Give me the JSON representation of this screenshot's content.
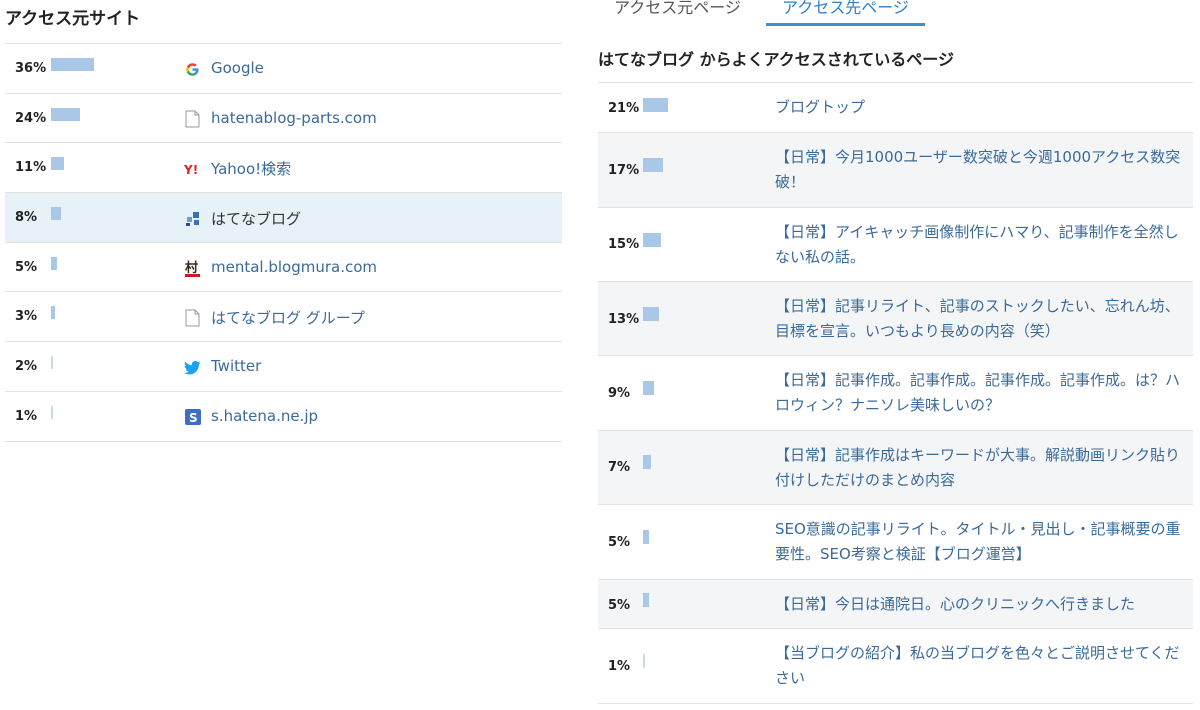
{
  "left": {
    "title": "アクセス元サイト",
    "rows": [
      {
        "pct": "36%",
        "fraction": 0.36,
        "icon": "google-icon",
        "name": "Google"
      },
      {
        "pct": "24%",
        "fraction": 0.24,
        "icon": "page-icon",
        "name": "hatenablog-parts.com"
      },
      {
        "pct": "11%",
        "fraction": 0.11,
        "icon": "yahoo-icon",
        "name": "Yahoo!検索"
      },
      {
        "pct": "8%",
        "fraction": 0.08,
        "icon": "hatenablog-icon",
        "name": "はてなブログ",
        "highlight": true
      },
      {
        "pct": "5%",
        "fraction": 0.05,
        "icon": "blogmura-icon",
        "name": "mental.blogmura.com"
      },
      {
        "pct": "3%",
        "fraction": 0.03,
        "icon": "page-icon",
        "name": "はてなブログ グループ"
      },
      {
        "pct": "2%",
        "fraction": 0.02,
        "icon": "twitter-icon",
        "name": "Twitter"
      },
      {
        "pct": "1%",
        "fraction": 0.01,
        "icon": "hatena-s-icon",
        "name": "s.hatena.ne.jp"
      }
    ]
  },
  "right": {
    "tabs": [
      {
        "label": "アクセス元ページ",
        "active": false
      },
      {
        "label": "アクセス先ページ",
        "active": true
      }
    ],
    "heading": "はてなブログ からよくアクセスされているページ",
    "rows": [
      {
        "pct": "21%",
        "fraction": 0.21,
        "title": "ブログトップ"
      },
      {
        "pct": "17%",
        "fraction": 0.17,
        "title": "【日常】今月1000ユーザー数突破と今週1000アクセス数突破！"
      },
      {
        "pct": "15%",
        "fraction": 0.15,
        "title": "【日常】アイキャッチ画像制作にハマり、記事制作を全然しない私の話。"
      },
      {
        "pct": "13%",
        "fraction": 0.13,
        "title": "【日常】記事リライト、記事のストックしたい、忘れん坊、目標を宣言。いつもより長めの内容（笑）"
      },
      {
        "pct": "9%",
        "fraction": 0.09,
        "title": "【日常】記事作成。記事作成。記事作成。記事作成。は？ハロウィン？ナニソレ美味しいの？"
      },
      {
        "pct": "7%",
        "fraction": 0.07,
        "title": "【日常】記事作成はキーワードが大事。解説動画リンク貼り付けしただけのまとめ内容"
      },
      {
        "pct": "5%",
        "fraction": 0.05,
        "title": "SEO意識の記事リライト。タイトル・見出し・記事概要の重要性。SEO考察と検証【ブログ運営】"
      },
      {
        "pct": "5%",
        "fraction": 0.05,
        "title": "【日常】今日は通院日。心のクリニックへ行きました"
      },
      {
        "pct": "1%",
        "fraction": 0.01,
        "title": "【当ブログの紹介】私の当ブログを色々とご説明させてください"
      }
    ]
  },
  "colors": {
    "bar": "#a9c8e8",
    "link": "#3a6a9a",
    "active_tab": "#2f7fc4",
    "highlight_row": "#e6f1f8"
  }
}
